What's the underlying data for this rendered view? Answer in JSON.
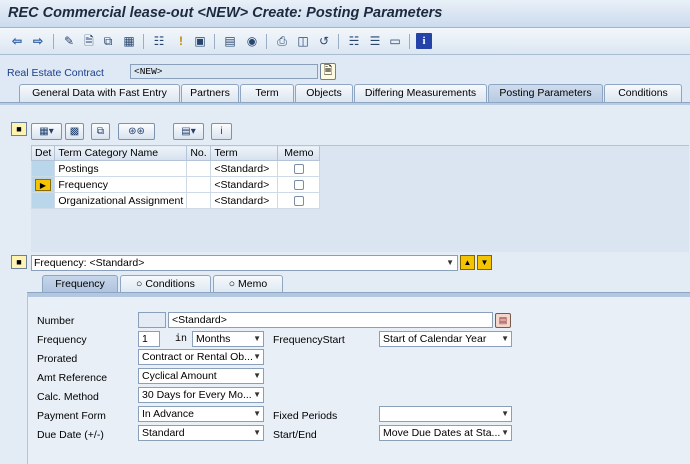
{
  "window": {
    "title": "REC Commercial lease-out <NEW> Create: Posting Parameters"
  },
  "toolbar": {
    "icons": [
      "back-arrow-icon",
      "forward-arrow-icon",
      "edit-pencil-icon",
      "new-document-icon",
      "copy-icon",
      "multi-object-icon",
      "tree-icon",
      "alert-icon",
      "save-icon",
      "attach-icon",
      "link-icon",
      "print-icon",
      "print-preview-icon",
      "undo-icon",
      "hierarchy-icon",
      "layout-icon",
      "screen-icon",
      "info-icon"
    ]
  },
  "contract": {
    "label": "Real Estate Contract",
    "value": "<NEW>"
  },
  "tabs": [
    "General Data with Fast Entry",
    "Partners",
    "Term",
    "Objects",
    "Differing Measurements",
    "Posting Parameters",
    "Conditions"
  ],
  "active_tab": "Posting Parameters",
  "terms_table": {
    "headers": {
      "det": "Det",
      "category": "Term Category Name",
      "no": "No.",
      "term": "Term",
      "memo": "Memo"
    },
    "rows": [
      {
        "category": "Postings",
        "no": "",
        "term": "<Standard>"
      },
      {
        "category": "Frequency",
        "no": "",
        "term": "<Standard>"
      },
      {
        "category": "Organizational Assignment",
        "no": "",
        "term": "<Standard>"
      }
    ]
  },
  "frequency_selector": {
    "value": "Frequency: <Standard>"
  },
  "subtabs": {
    "frequency": "Frequency",
    "conditions": "Conditions",
    "memo": "Memo"
  },
  "form": {
    "number": {
      "label": "Number",
      "value": "",
      "text": "<Standard>"
    },
    "frequency": {
      "label": "Frequency",
      "value": "1",
      "in_label": "in",
      "unit": "Months"
    },
    "frequency_start": {
      "label": "FrequencyStart",
      "value": "Start of Calendar Year"
    },
    "prorated": {
      "label": "Prorated",
      "value": "Contract or Rental Ob..."
    },
    "amt_reference": {
      "label": "Amt Reference",
      "value": "Cyclical Amount"
    },
    "calc_method": {
      "label": "Calc. Method",
      "value": "30 Days for Every Mo..."
    },
    "payment_form": {
      "label": "Payment Form",
      "value": "In Advance"
    },
    "fixed_periods": {
      "label": "Fixed Periods",
      "value": ""
    },
    "due_date": {
      "label": "Due Date (+/-)",
      "value": "Standard"
    },
    "start_end": {
      "label": "Start/End",
      "value": "Move Due Dates at Sta..."
    }
  }
}
